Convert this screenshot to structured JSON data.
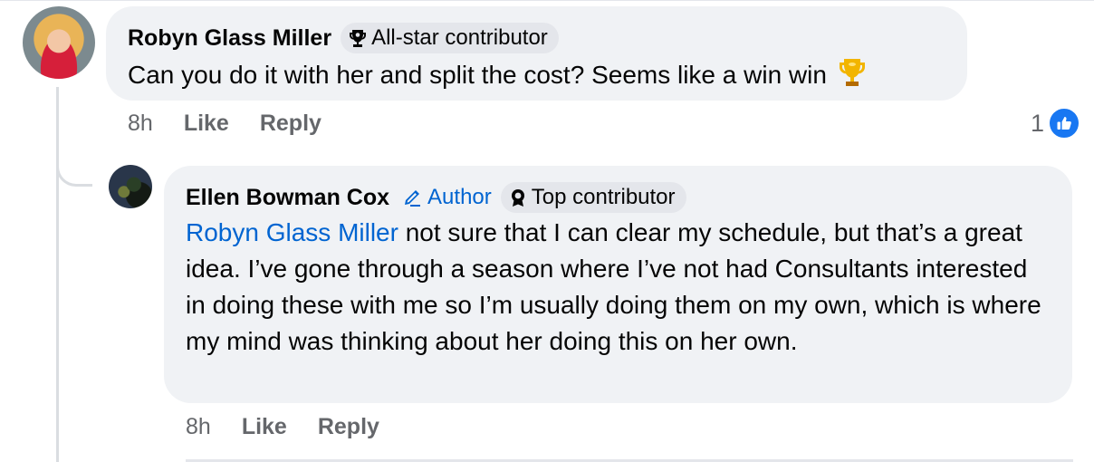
{
  "comments": [
    {
      "author": "Robyn Glass Miller",
      "badge": "All-star contributor",
      "badge_icon": "trophy-badge-icon",
      "text": "Can you do it with her and split the cost?  Seems like a win win",
      "emoji": "trophy-emoji",
      "time": "8h",
      "like_label": "Like",
      "reply_label": "Reply",
      "reaction_count": "1",
      "reaction_icon": "like-reaction-icon"
    },
    {
      "author": "Ellen Bowman Cox",
      "author_tag": "Author",
      "badge": "Top contributor",
      "badge_icon": "rosette-badge-icon",
      "mention": "Robyn Glass Miller",
      "text": " not sure that I can clear my schedule, but that’s a great idea. I’ve gone through a season where I’ve not had Consultants interested in doing these with me so I’m usually doing them on my own, which is where my mind was thinking about her doing this on her own.",
      "time": "8h",
      "like_label": "Like",
      "reply_label": "Reply"
    }
  ],
  "colors": {
    "bubble": "#f0f2f5",
    "badge": "#e4e6eb",
    "link": "#0064d1",
    "meta": "#65676b",
    "like_blue": "#1877f2"
  }
}
